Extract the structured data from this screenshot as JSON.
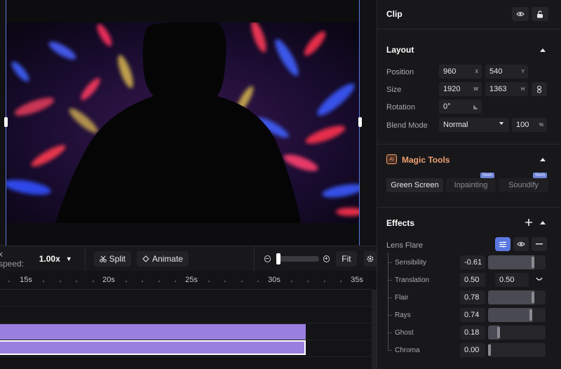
{
  "toolbar": {
    "speed_label": "x speed:",
    "speed_value": "1.00x",
    "split_label": "Split",
    "animate_label": "Animate",
    "fit_label": "Fit"
  },
  "timeline": {
    "ticks": [
      "15s",
      "20s",
      "25s",
      "30s",
      "35s"
    ]
  },
  "panel": {
    "clip_title": "Clip",
    "layout": {
      "title": "Layout",
      "position_label": "Position",
      "position_x": "960",
      "position_x_unit": "X",
      "position_y": "540",
      "position_y_unit": "Y",
      "size_label": "Size",
      "size_w": "1920",
      "size_w_unit": "W",
      "size_h": "1363",
      "size_h_unit": "H",
      "rotation_label": "Rotation",
      "rotation_value": "0°",
      "blend_label": "Blend Mode",
      "blend_value": "Normal",
      "opacity_value": "100",
      "opacity_unit": "%"
    },
    "magic": {
      "badge": "AI",
      "title": "Magic Tools",
      "tabs": [
        {
          "label": "Green Screen"
        },
        {
          "label": "Inpainting",
          "badge": "Soon"
        },
        {
          "label": "Soundify",
          "badge": "Soon"
        }
      ]
    },
    "effects": {
      "title": "Effects",
      "effect_name": "Lens Flare",
      "params": [
        {
          "label": "Sensibility",
          "value": "-0.61",
          "level": 0.8
        },
        {
          "label": "Translation",
          "value": "0.50",
          "value2": "0.50"
        },
        {
          "label": "Flair",
          "value": "0.78",
          "level": 0.8
        },
        {
          "label": "Rays",
          "value": "0.74",
          "level": 0.77
        },
        {
          "label": "Ghost",
          "value": "0.18",
          "level": 0.2
        },
        {
          "label": "Chroma",
          "value": "0.00",
          "level": 0.0
        }
      ]
    }
  },
  "colors": {
    "accent": "#5b78e0",
    "clip": "#9a80de",
    "magic": "#f0a070"
  }
}
